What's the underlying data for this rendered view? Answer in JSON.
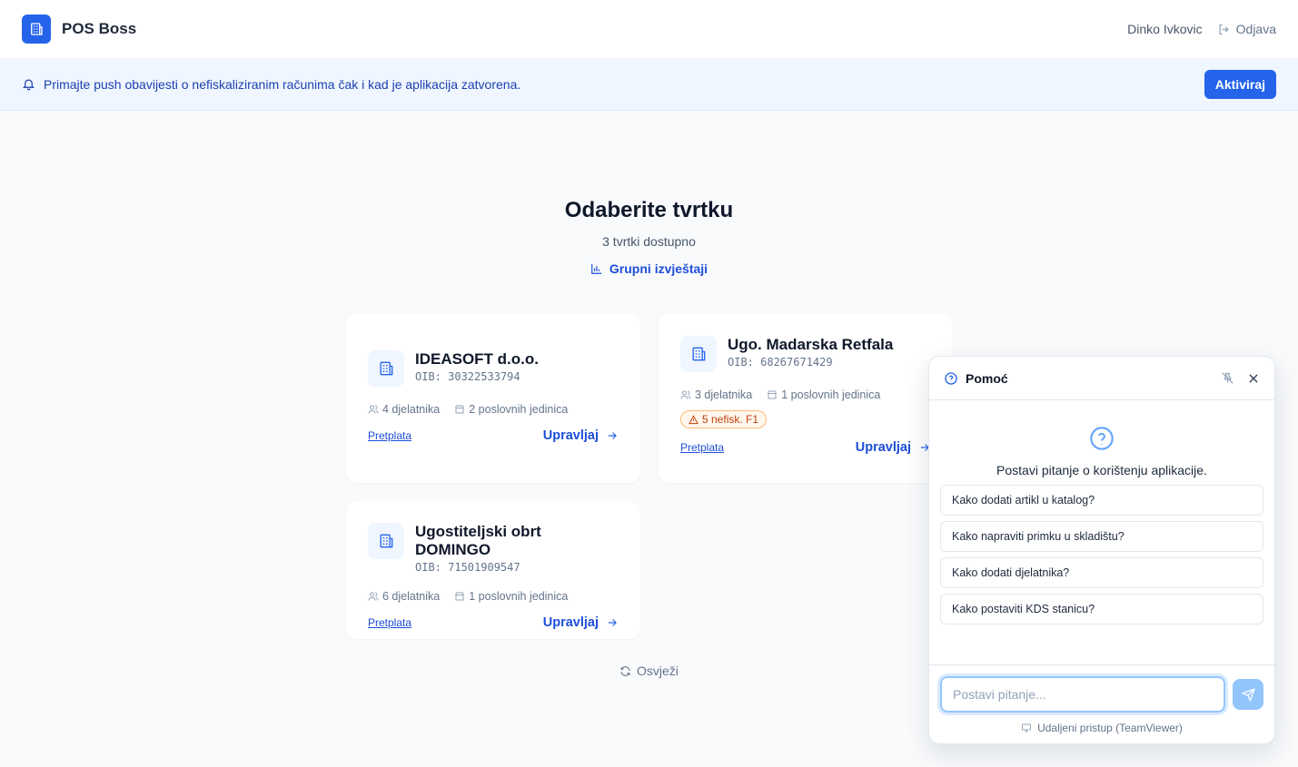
{
  "header": {
    "app_name": "POS Boss",
    "user_name": "Dinko Ivkovic",
    "logout_label": "Odjava"
  },
  "banner": {
    "text": "Primajte push obavijesti o nefiskaliziranim računima čak i kad je aplikacija zatvorena.",
    "button_label": "Aktiviraj"
  },
  "page": {
    "title": "Odaberite tvrtku",
    "subtitle": "3 tvrtki dostupno",
    "group_reports_label": "Grupni izvještaji",
    "refresh_label": "Osvježi"
  },
  "companies": [
    {
      "name": "IDEASOFT d.o.o.",
      "oib": "OIB: 30322533794",
      "employees": "4 djelatnika",
      "units": "2 poslovnih jedinica",
      "subscription_label": "Pretplata",
      "manage_label": "Upravljaj"
    },
    {
      "name": "Ugo. Madarska Retfala",
      "oib": "OIB: 68267671429",
      "employees": "3 djelatnika",
      "units": "1 poslovnih jedinica",
      "warning": "5 nefisk. F1",
      "subscription_label": "Pretplata",
      "manage_label": "Upravljaj"
    },
    {
      "name": "Ugostiteljski obrt DOMINGO",
      "oib": "OIB: 71501909547",
      "employees": "6 djelatnika",
      "units": "1 poslovnih jedinica",
      "subscription_label": "Pretplata",
      "manage_label": "Upravljaj"
    }
  ],
  "help": {
    "title": "Pomoć",
    "prompt": "Postavi pitanje o korištenju aplikacije.",
    "suggestions": [
      "Kako dodati artikl u katalog?",
      "Kako napraviti primku u skladištu?",
      "Kako dodati djelatnika?",
      "Kako postaviti KDS stanicu?"
    ],
    "input_placeholder": "Postavi pitanje...",
    "remote_label": "Udaljeni pristup (TeamViewer)"
  },
  "colors": {
    "accent": "#2563eb",
    "banner_bg": "#eff6ff",
    "warning": "#c2410c",
    "page_bg": "#f8fafc"
  }
}
